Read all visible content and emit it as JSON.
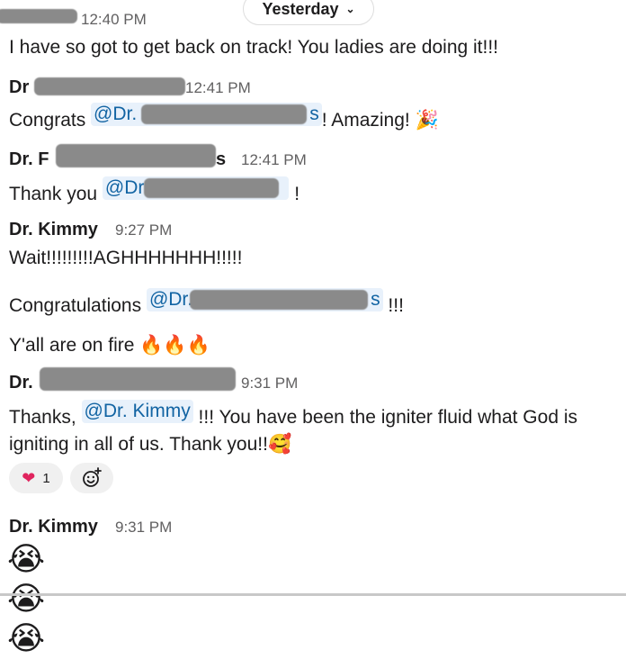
{
  "day_divider": {
    "label": "Yesterday",
    "chevron_icon": "chevron-down-icon"
  },
  "messages": [
    {
      "time": "12:40 PM",
      "text": "I have so got to get back on track! You ladies are doing it!!!"
    },
    {
      "author": "Dr",
      "time": "12:41 PM",
      "prefix": "Congrats ",
      "mention": "@Dr.",
      "mention_tail": "s",
      "suffix": "! Amazing! ",
      "emoji_icon": "party-popper-icon"
    },
    {
      "author": "Dr. F",
      "author_tail": "s",
      "time": "12:41 PM",
      "prefix": "Thank you ",
      "mention": "@Dr",
      "suffix": " !"
    },
    {
      "author": "Dr. Kimmy",
      "time": "9:27 PM",
      "lines": [
        "Wait!!!!!!!!!AGHHHHHHH!!!!!"
      ],
      "congrats_prefix": "Congratulations ",
      "congrats_mention": "@Dr.",
      "congrats_mention_tail": "s",
      "congrats_suffix": " !!!",
      "fire_line": "Y'all are on fire ",
      "fire_icon": "fire-icon"
    },
    {
      "author": "Dr.",
      "time": "9:31 PM",
      "prefix": "Thanks, ",
      "mention": "@Dr. Kimmy",
      "suffix": " !!! You have been the igniter fluid what God is",
      "line2": "igniting in all of us. Thank you!!",
      "emoji_icon": "smiling-face-with-hearts-icon",
      "reaction": {
        "icon": "red-heart-icon",
        "count": "1"
      },
      "add_reaction_icon": "add-reaction-icon"
    },
    {
      "author": "Dr. Kimmy",
      "time": "9:31 PM",
      "emoji_icon": "loudly-crying-face-icon"
    }
  ]
}
